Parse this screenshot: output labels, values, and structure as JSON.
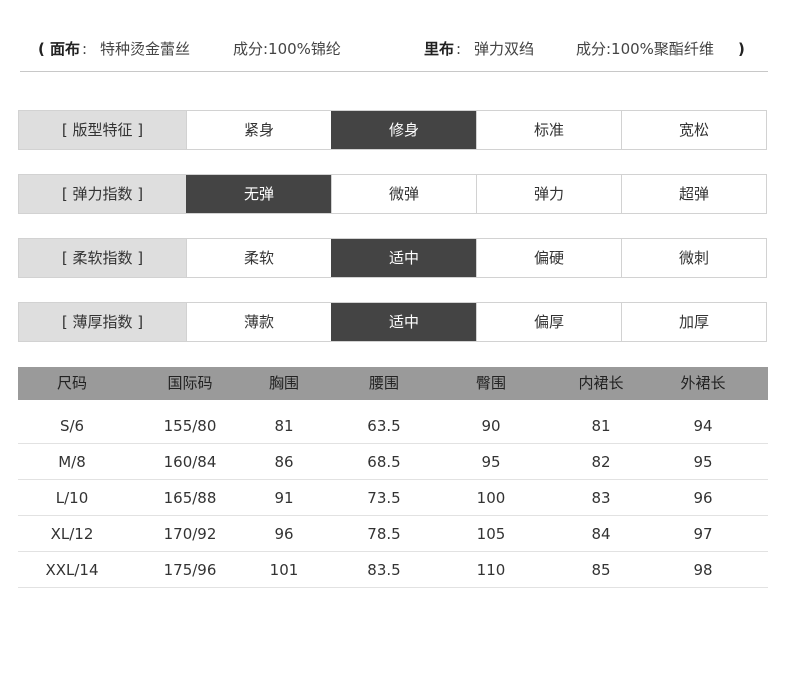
{
  "fabric": {
    "open_paren": "(",
    "outer_label": "面布",
    "outer_colon": ":",
    "outer_value": "特种烫金蕾丝",
    "outer_comp": "成分:100%锦纶",
    "lining_label": "里布",
    "lining_colon": ":",
    "lining_value": "弹力双绉",
    "lining_comp": "成分:100%聚酯纤维",
    "close_paren": ")"
  },
  "attributes": [
    {
      "label": "[ 版型特征 ]",
      "options": [
        "紧身",
        "修身",
        "标准",
        "宽松"
      ],
      "selected": 1
    },
    {
      "label": "[ 弹力指数 ]",
      "options": [
        "无弹",
        "微弹",
        "弹力",
        "超弹"
      ],
      "selected": 0
    },
    {
      "label": "[ 柔软指数 ]",
      "options": [
        "柔软",
        "适中",
        "偏硬",
        "微刺"
      ],
      "selected": 1
    },
    {
      "label": "[ 薄厚指数 ]",
      "options": [
        "薄款",
        "适中",
        "偏厚",
        "加厚"
      ],
      "selected": 1
    }
  ],
  "size_table": {
    "headers": [
      "尺码",
      "国际码",
      "胸围",
      "腰围",
      "臀围",
      "内裙长",
      "外裙长"
    ],
    "rows": [
      [
        "S/6",
        "155/80",
        "81",
        "63.5",
        "90",
        "81",
        "94"
      ],
      [
        "M/8",
        "160/84",
        "86",
        "68.5",
        "95",
        "82",
        "95"
      ],
      [
        "L/10",
        "165/88",
        "91",
        "73.5",
        "100",
        "83",
        "96"
      ],
      [
        "XL/12",
        "170/92",
        "96",
        "78.5",
        "105",
        "84",
        "97"
      ],
      [
        "XXL/14",
        "175/96",
        "101",
        "83.5",
        "110",
        "85",
        "98"
      ]
    ]
  },
  "colors": {
    "selected_bg": "#444444",
    "label_bg": "#dedede",
    "header_bg": "#9a9a9a"
  }
}
